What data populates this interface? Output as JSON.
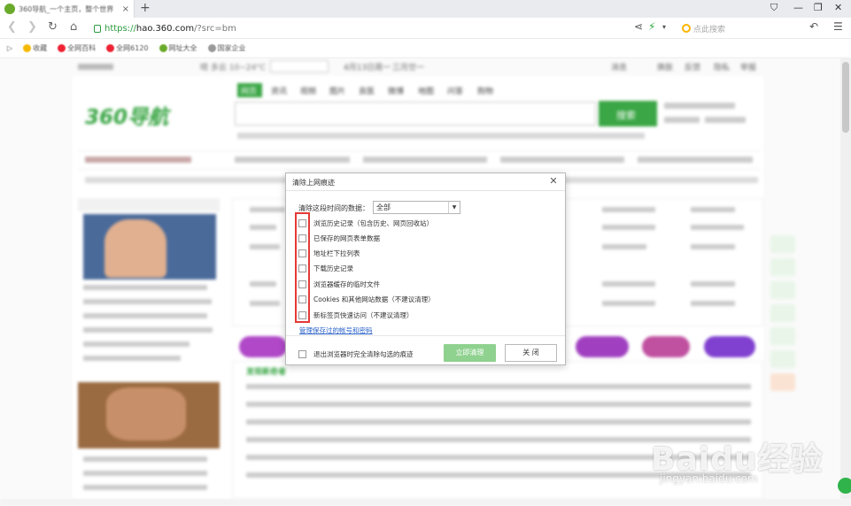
{
  "tab": {
    "title": "360导航_一个主页，整个世界",
    "close": "×",
    "new": "+"
  },
  "address": {
    "https": "https://",
    "host": "hao.360.com",
    "path": "/?src=bm"
  },
  "search": {
    "placeholder": "点此搜索"
  },
  "bookmarks": [
    "收藏",
    "全网百科",
    "全网6120",
    "网址大全",
    "国家企业"
  ],
  "page": {
    "logo": "360导航",
    "search_tabs": [
      "网页",
      "资讯",
      "视频",
      "图片",
      "良医",
      "微博",
      "地图",
      "问答",
      "购物"
    ],
    "search_button": "搜索",
    "weather": "晴 多云 10~24°C",
    "date": "4月13日周一",
    "lunar": "三月廿一",
    "top_right": [
      "消息",
      "换肤",
      "反馈",
      "隐私",
      "举报"
    ],
    "section_title": "发现新奇者"
  },
  "dialog": {
    "title": "清除上网痕迹",
    "range_label": "清除这段时间的数据：",
    "range_value": "全部",
    "options": [
      "浏览历史记录（包含历史、网页回收站）",
      "已保存的网页表单数据",
      "地址栏下拉列表",
      "下载历史记录",
      "浏览器缓存的临时文件",
      "Cookies 和其他网站数据（不建议清理）",
      "新标签页快速访问（不建议清理）"
    ],
    "manage_link": "管理保存过的帐号和密码",
    "exit_option": "退出浏览器时完全清除勾选的痕迹",
    "clear_button": "立即清理",
    "close_button": "关 闭"
  },
  "watermark": {
    "main": "Baidu经验",
    "sub": "jingyan.baidu.com"
  },
  "colors": {
    "accent_green": "#2c9c3e",
    "clear_button": "#8fd18f",
    "highlight_red": "#e53935",
    "link_blue": "#2a62c9"
  }
}
